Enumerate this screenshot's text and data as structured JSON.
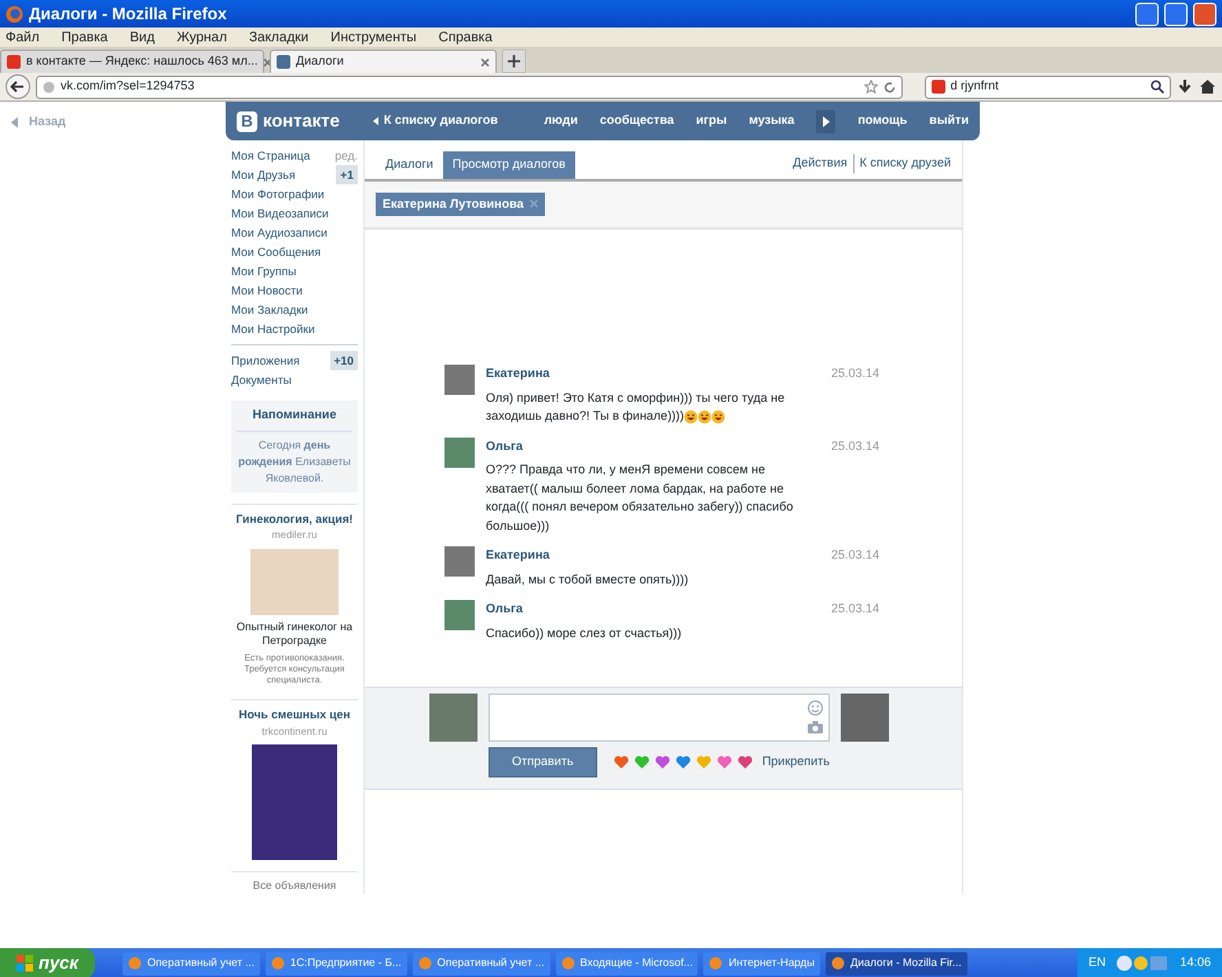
{
  "window": {
    "title": "Диалоги - Mozilla Firefox"
  },
  "menu": [
    "Файл",
    "Правка",
    "Вид",
    "Журнал",
    "Закладки",
    "Инструменты",
    "Справка"
  ],
  "browser_tabs": [
    {
      "label": "в контакте — Яндекс: нашлось 463 мл...",
      "selected": false
    },
    {
      "label": "Диалоги",
      "selected": true
    }
  ],
  "address_bar": {
    "value": "vk.com/im?sel=1294753"
  },
  "search_bar": {
    "value": "d rjynfrnt"
  },
  "back_link": "Назад",
  "vk_header": {
    "logo_mark": "В",
    "logo_text": "контакте",
    "back_to_dialogs": "К списку диалогов",
    "nav": [
      "люди",
      "сообщества",
      "игры",
      "музыка",
      "помощь",
      "выйти"
    ]
  },
  "sidebar": {
    "items": [
      {
        "label": "Моя Страница",
        "extra": "ред."
      },
      {
        "label": "Мои Друзья",
        "badge": "+1"
      },
      {
        "label": "Мои Фотографии"
      },
      {
        "label": "Мои Видеозаписи"
      },
      {
        "label": "Мои Аудиозаписи"
      },
      {
        "label": "Мои Сообщения"
      },
      {
        "label": "Мои Группы"
      },
      {
        "label": "Мои Новости"
      },
      {
        "label": "Мои Закладки"
      },
      {
        "label": "Мои Настройки"
      }
    ],
    "items_2": [
      {
        "label": "Приложения",
        "badge": "+10"
      },
      {
        "label": "Документы"
      }
    ],
    "reminder": {
      "title": "Напоминание",
      "text": "Сегодня **день рождения** Елизаветы Яковлевой."
    },
    "ads": [
      {
        "title": "Гинекология, акция!",
        "domain": "mediler.ru",
        "caption": "Опытный гинеколог на Петроградке",
        "note": "Есть противопоказания. Требуется консультация специалиста."
      },
      {
        "title": "Ночь смешных цен",
        "domain": "trkcontinent.ru"
      }
    ],
    "all_ads": "Все объявления"
  },
  "tabs": [
    {
      "label": "Диалоги",
      "selected": false
    },
    {
      "label": "Просмотр диалогов",
      "selected": true
    }
  ],
  "actions": [
    "Действия",
    "К списку друзей"
  ],
  "chip": "Екатерина Лутовинова",
  "messages": [
    {
      "author": "Екатерина",
      "date": "25.03.14",
      "text": "Оля) привет! Это Катя с оморфин))) ты чего туда не заходишь давно?! Ты в финале))))",
      "emojis": [
        {
          "kind": "laughing"
        },
        {
          "kind": "laughing"
        },
        {
          "kind": "laughing"
        }
      ]
    },
    {
      "author": "Ольга",
      "date": "25.03.14",
      "text": "О??? Правда что ли, у менЯ времени совсем не хватает(( малыш болеет лома бардак, на работе не когда((( понял вечером обязательно забегу)) спасибо большое)))"
    },
    {
      "author": "Екатерина",
      "date": "25.03.14",
      "text": "Давай, мы с тобой вместе опять))))"
    },
    {
      "author": "Ольга",
      "date": "25.03.14",
      "text": "Спасибо)) море слез от счастья)))"
    }
  ],
  "composer": {
    "send_button": "Отправить",
    "hearts": [
      {
        "color": "#f05a1e"
      },
      {
        "color": "#2ec02e"
      },
      {
        "color": "#c04ee0"
      },
      {
        "color": "#1e88e0"
      },
      {
        "color": "#f2b400"
      },
      {
        "color": "#f060b8"
      },
      {
        "color": "#e0407a"
      }
    ],
    "attach": "Прикрепить"
  },
  "taskbar": {
    "start": "пуск",
    "items": [
      {
        "label": "Оперативный учет ...",
        "selected": false
      },
      {
        "label": "1С:Предприятие - Б...",
        "selected": false
      },
      {
        "label": "Оперативный учет ...",
        "selected": false
      },
      {
        "label": "Входящие - Microsof...",
        "selected": false
      },
      {
        "label": "Интернет-Нарды",
        "selected": false
      },
      {
        "label": "Диалоги - Mozilla Fir...",
        "selected": true
      }
    ],
    "lang": "EN",
    "clock": "14:06"
  }
}
